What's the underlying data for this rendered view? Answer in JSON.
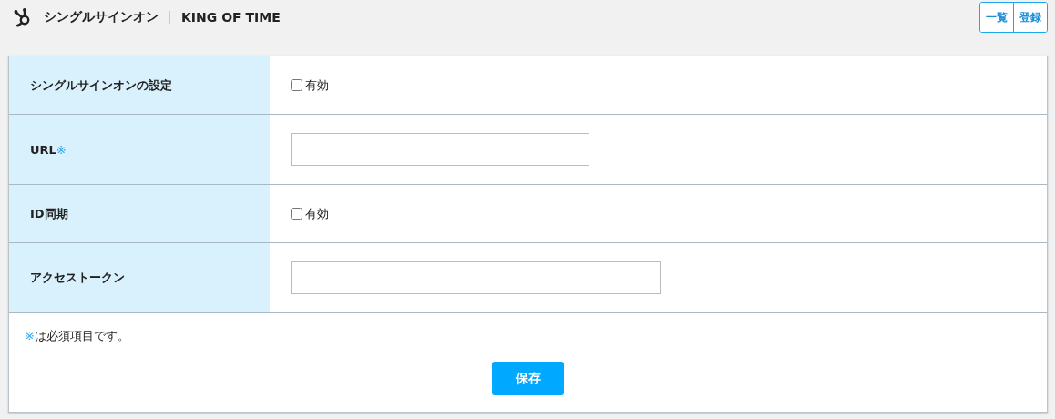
{
  "header": {
    "title": "シングルサインオン",
    "subtitle": "KING OF TIME",
    "buttons": [
      "一覧",
      "登録"
    ]
  },
  "rows": [
    {
      "label": "シングルサインオンの設定",
      "kind": "checkbox",
      "option": "有効",
      "checked": false
    },
    {
      "label": "URL",
      "required_mark": "※",
      "kind": "short_input"
    },
    {
      "label": "ID同期",
      "kind": "checkbox",
      "option": "有効",
      "checked": false
    },
    {
      "label": "アクセストークン",
      "kind": "long_input"
    }
  ],
  "note": {
    "mark": "※",
    "text": "は必須項目です。"
  },
  "save_button": "保存"
}
